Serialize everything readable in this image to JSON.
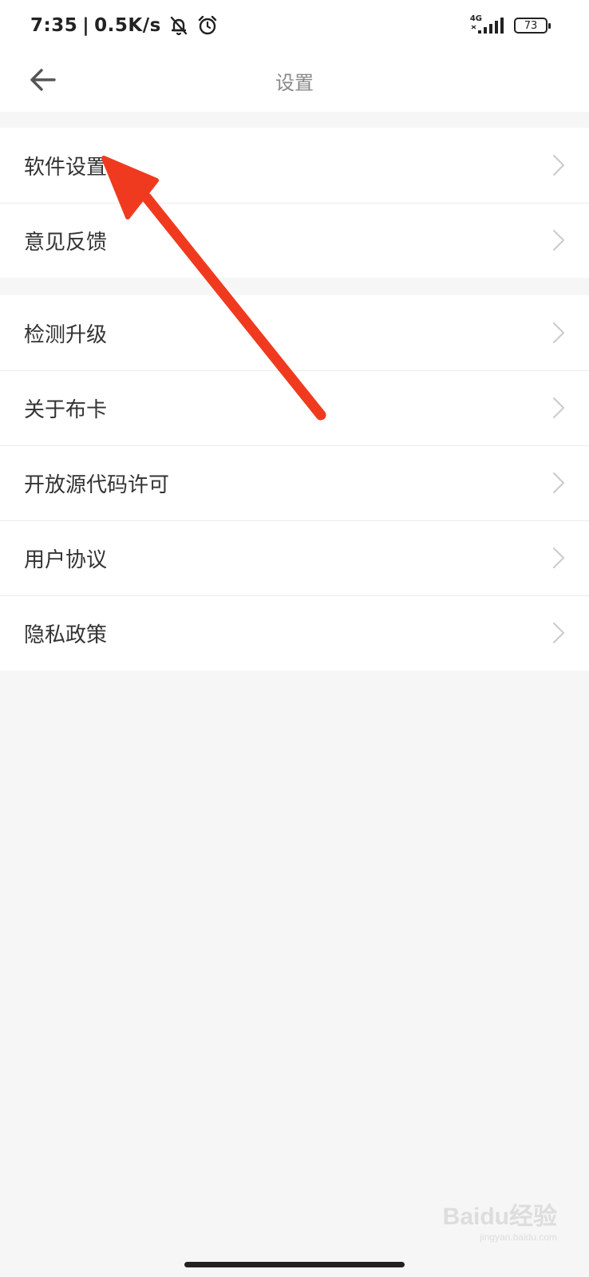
{
  "statusbar": {
    "time": "7:35",
    "separator": "|",
    "net_speed": "0.5K/s",
    "network_type": "4G",
    "battery_level": "73",
    "icons": [
      "bell-off-icon",
      "alarm-icon",
      "signal-icon",
      "battery-icon"
    ]
  },
  "nav": {
    "title": "设置",
    "back_icon": "back-arrow-icon"
  },
  "groups": [
    {
      "items": [
        {
          "label": "软件设置"
        },
        {
          "label": "意见反馈"
        }
      ]
    },
    {
      "items": [
        {
          "label": "检测升级"
        },
        {
          "label": "关于布卡"
        },
        {
          "label": "开放源代码许可"
        },
        {
          "label": "用户协议"
        },
        {
          "label": "隐私政策"
        }
      ]
    }
  ],
  "annotation": {
    "color": "#f03a1f",
    "icon": "annotation-arrow"
  },
  "watermark": {
    "brand": "Baidu经验",
    "url": "jingyan.baidu.com"
  },
  "colors": {
    "background": "#f6f6f6",
    "text": "#333333",
    "title": "#888888",
    "chevron": "#cccccc"
  }
}
